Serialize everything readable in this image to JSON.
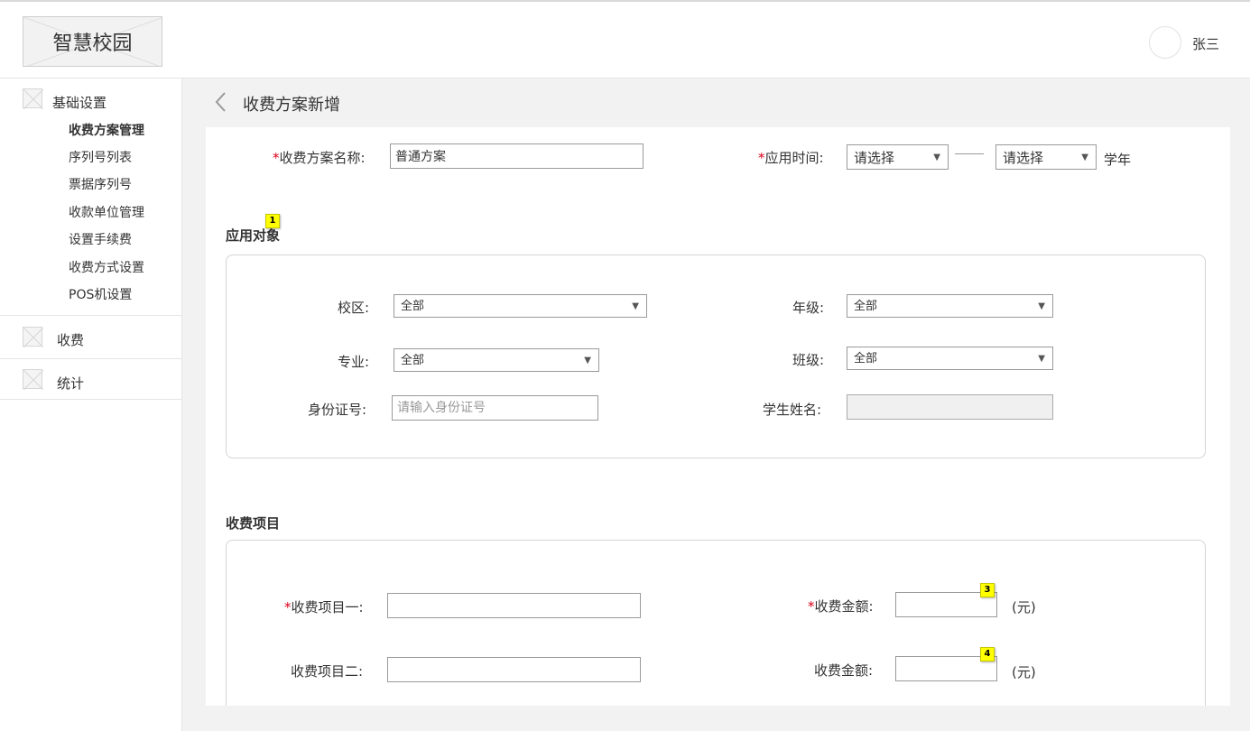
{
  "header": {
    "logo_text": "智慧校园",
    "username": "张三"
  },
  "sidebar": {
    "groups": [
      {
        "label": "基础设置",
        "icon": "placeholder-image-icon"
      },
      {
        "label": "收费",
        "icon": "placeholder-image-icon"
      },
      {
        "label": "统计",
        "icon": "placeholder-image-icon"
      }
    ],
    "sub_items": [
      "收费方案管理",
      "序列号列表",
      "票据序列号",
      "收款单位管理",
      "设置手续费",
      "收费方式设置",
      "POS机设置"
    ],
    "active_sub_item": "收费方案管理"
  },
  "page": {
    "title": "收费方案新增"
  },
  "form": {
    "plan_name_label": "收费方案名称:",
    "plan_name_value": "普通方案",
    "apply_time_label": "应用时间:",
    "apply_time_start": "请选择",
    "apply_time_end": "请选择",
    "apply_time_suffix": "学年",
    "required_mark": "*"
  },
  "target_section": {
    "title": "应用对象",
    "badge": "1",
    "campus_label": "校区:",
    "campus_value": "全部",
    "grade_label": "年级:",
    "grade_value": "全部",
    "major_label": "专业:",
    "major_value": "全部",
    "class_label": "班级:",
    "class_value": "全部",
    "id_label": "身份证号:",
    "id_placeholder": "请输入身份证号",
    "name_label": "学生姓名:"
  },
  "fee_section": {
    "title": "收费项目",
    "item1_label": "收费项目一:",
    "item2_label": "收费项目二:",
    "amount_label": "收费金额:",
    "unit": "(元)",
    "badge3": "3",
    "badge4": "4"
  },
  "colors": {
    "required": "#d9001b",
    "main_bg": "#f2f2f2",
    "badge": "#ffff00"
  }
}
